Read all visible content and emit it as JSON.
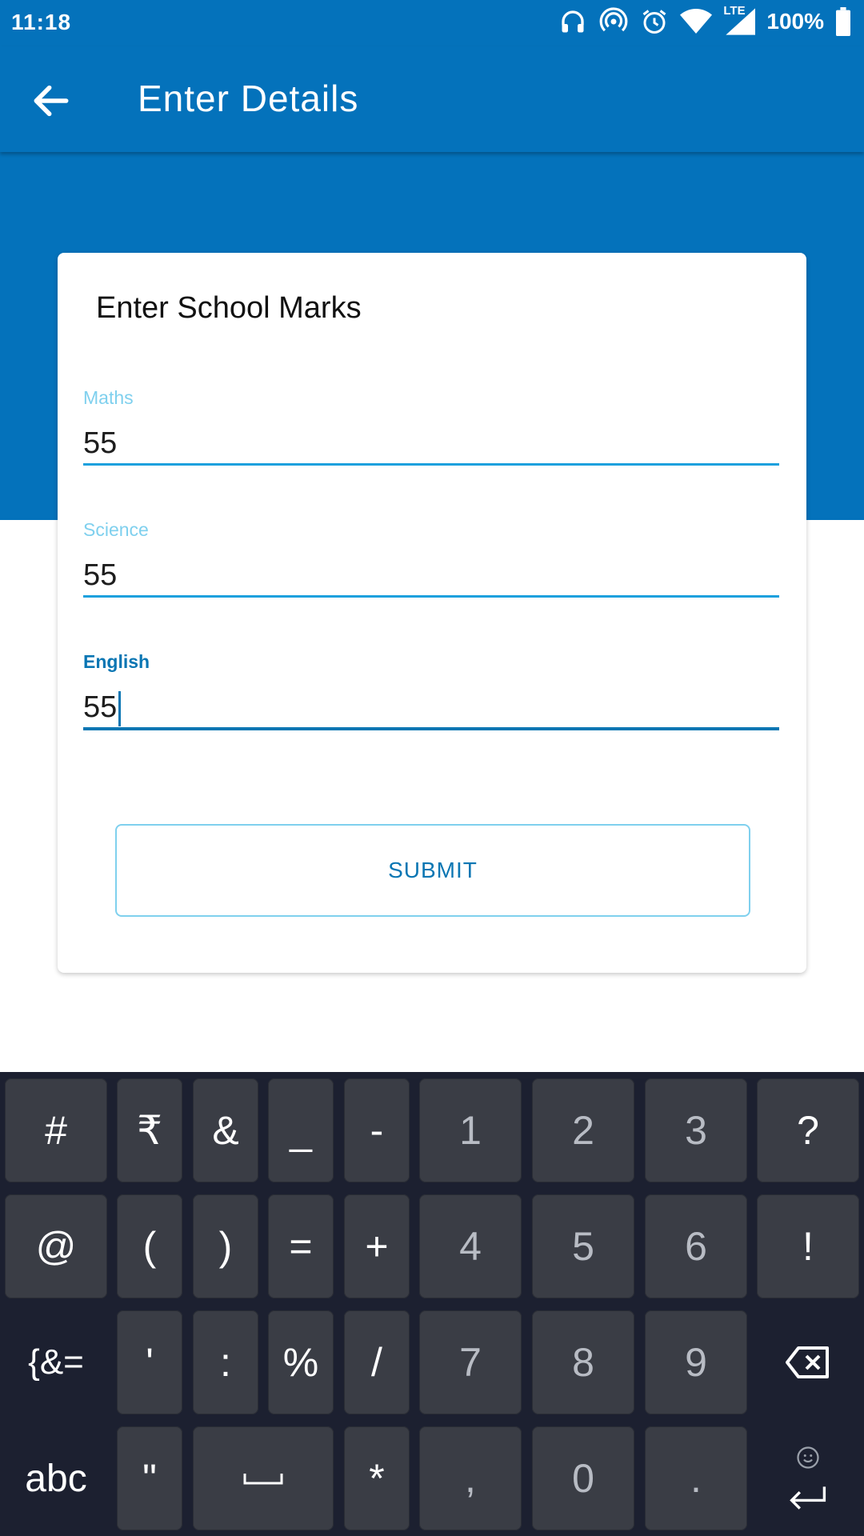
{
  "status_bar": {
    "time": "11:18",
    "network": "LTE",
    "battery": "100%",
    "icons": [
      "headphones-icon",
      "hotspot-icon",
      "alarm-icon",
      "wifi-icon",
      "signal-icon",
      "battery-icon"
    ]
  },
  "app_bar": {
    "back_icon": "arrow-back-icon",
    "title": "Enter Details"
  },
  "form": {
    "title": "Enter School Marks",
    "fields": [
      {
        "label": "Maths",
        "value": "55"
      },
      {
        "label": "Science",
        "value": "55"
      },
      {
        "label": "English",
        "value": "55"
      }
    ],
    "submit_label": "SUBMIT"
  },
  "keyboard": {
    "rows": [
      [
        "#",
        "₹",
        "&",
        "_",
        "-",
        "1",
        "2",
        "3",
        "?"
      ],
      [
        "@",
        "(",
        ")",
        "=",
        "+",
        "4",
        "5",
        "6",
        "!"
      ],
      [
        "{&=",
        "'",
        ":",
        "%",
        "/",
        "7",
        "8",
        "9",
        "backspace"
      ],
      [
        "abc",
        "\"",
        "space",
        "*",
        ",",
        "0",
        ".",
        "enter"
      ]
    ]
  },
  "colors": {
    "primary": "#0472bb",
    "accent_light": "#7fd0ee",
    "accent_dark": "#0a76b3",
    "keyboard_bg": "#1c2030",
    "key_bg": "#3a3d45"
  }
}
